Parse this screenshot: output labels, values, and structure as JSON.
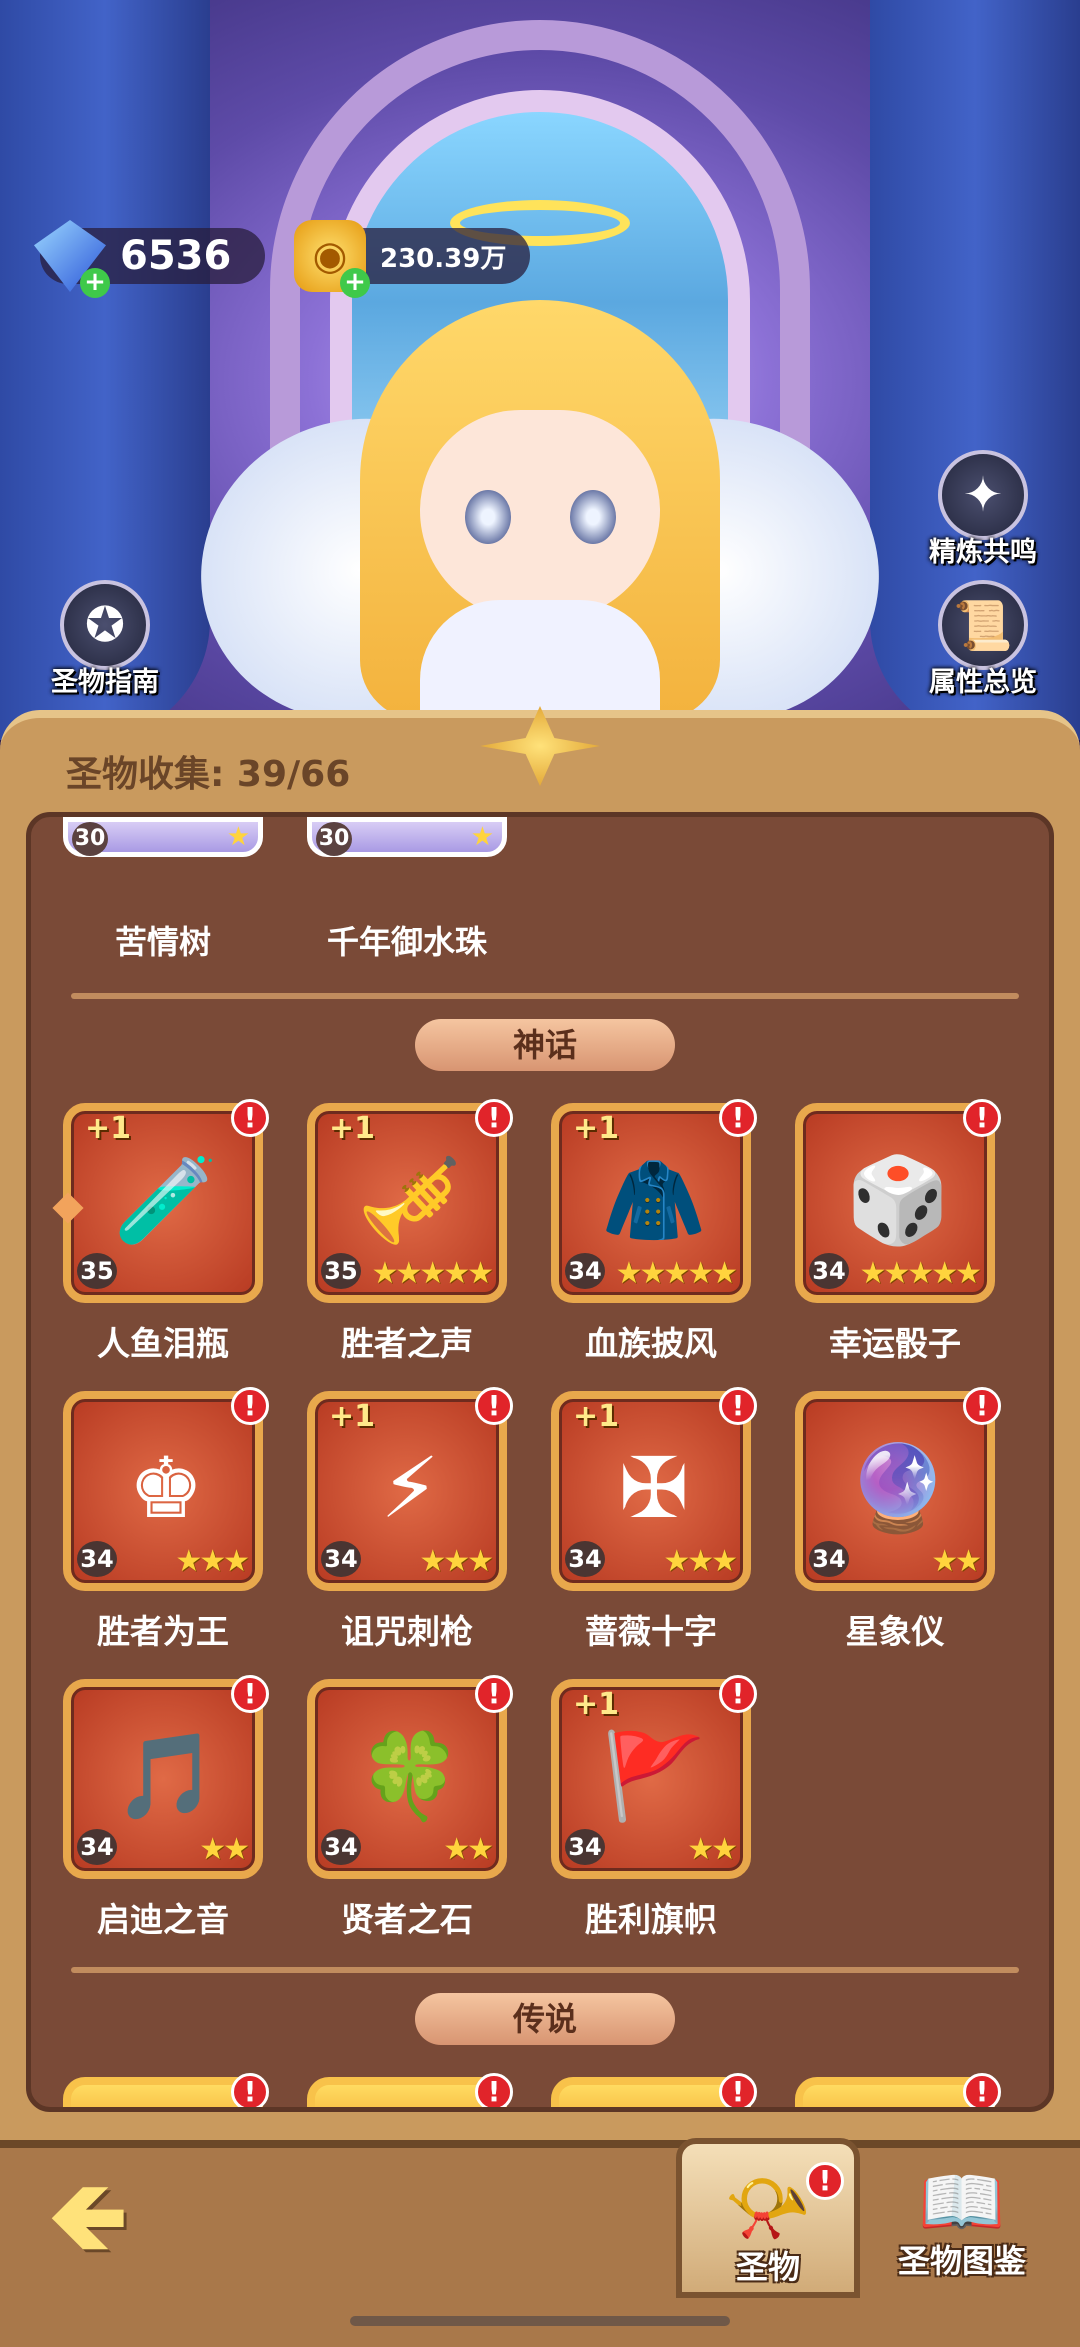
{
  "currency": {
    "gems": "6536",
    "gold": "230.39万",
    "gem_icon": "gem-icon",
    "gold_icon": "gold-coin-icon"
  },
  "side_buttons": {
    "guide": "圣物指南",
    "refine": "精炼共鸣",
    "overview": "属性总览"
  },
  "collection": {
    "label": "圣物收集: 39/66"
  },
  "top_row": [
    {
      "name": "苦情树",
      "level": "30"
    },
    {
      "name": "千年御水珠",
      "level": "30"
    }
  ],
  "mythic": {
    "label": "神话",
    "items": [
      {
        "name": "人鱼泪瓶",
        "level": "35",
        "bonus": "+1",
        "stars": "",
        "icon": "potion-icon",
        "glyph": "🧪"
      },
      {
        "name": "胜者之声",
        "level": "35",
        "bonus": "+1",
        "stars": "★★★★★",
        "icon": "flute-icon",
        "glyph": "🎺"
      },
      {
        "name": "血族披风",
        "level": "34",
        "bonus": "+1",
        "stars": "★★★★★",
        "icon": "cloak-icon",
        "glyph": "🧥"
      },
      {
        "name": "幸运骰子",
        "level": "34",
        "bonus": "",
        "stars": "★★★★★",
        "icon": "dice-icon",
        "glyph": "🎲"
      },
      {
        "name": "胜者为王",
        "level": "34",
        "bonus": "",
        "stars": "★★★",
        "icon": "chess-king-icon",
        "glyph": "♚"
      },
      {
        "name": "诅咒刺枪",
        "level": "34",
        "bonus": "+1",
        "stars": "★★★",
        "icon": "spear-icon",
        "glyph": "⚡"
      },
      {
        "name": "蔷薇十字",
        "level": "34",
        "bonus": "+1",
        "stars": "★★★",
        "icon": "rose-cross-icon",
        "glyph": "✠"
      },
      {
        "name": "星象仪",
        "level": "34",
        "bonus": "",
        "stars": "★★",
        "icon": "orrery-icon",
        "glyph": "🔮"
      },
      {
        "name": "启迪之音",
        "level": "34",
        "bonus": "",
        "stars": "★★",
        "icon": "harp-icon",
        "glyph": "🎵"
      },
      {
        "name": "贤者之石",
        "level": "34",
        "bonus": "",
        "stars": "★★",
        "icon": "stone-icon",
        "glyph": "🍀"
      },
      {
        "name": "胜利旗帜",
        "level": "34",
        "bonus": "+1",
        "stars": "★★",
        "icon": "banner-icon",
        "glyph": "🚩"
      }
    ]
  },
  "legend": {
    "label": "传说"
  },
  "alert": "!",
  "tabs": {
    "relic": "圣物",
    "codex": "圣物图鉴",
    "back": "🡸"
  }
}
